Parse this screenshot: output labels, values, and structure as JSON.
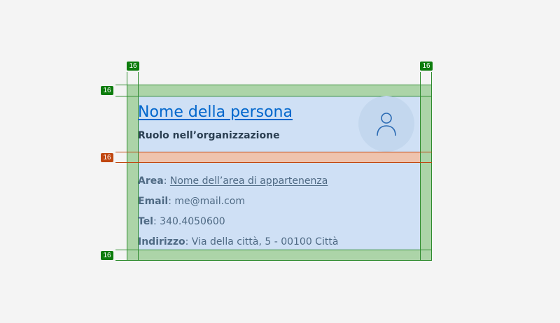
{
  "spacing_badges": {
    "top_left": "16",
    "top_right": "16",
    "side_top": "16",
    "side_middle": "16",
    "side_bottom": "16"
  },
  "card": {
    "title": "Nome della persona",
    "role": "Ruolo nell’organizzazione",
    "avatar_icon": "user-icon",
    "fields": {
      "area_label": "Area",
      "area_value": "Nome dell’area di appartenenza",
      "email_label": "Email",
      "email_value": "me@mail.com",
      "tel_label": "Tel",
      "tel_value": "340.4050600",
      "address_label": "Indirizzo",
      "address_value": "Via della città, 5 - 00100 Città"
    }
  },
  "colors": {
    "padding_overlay": "#acd4a8",
    "divider_overlay": "#efc3ad",
    "card_background": "#cfe0f5",
    "link": "#0066cc"
  }
}
